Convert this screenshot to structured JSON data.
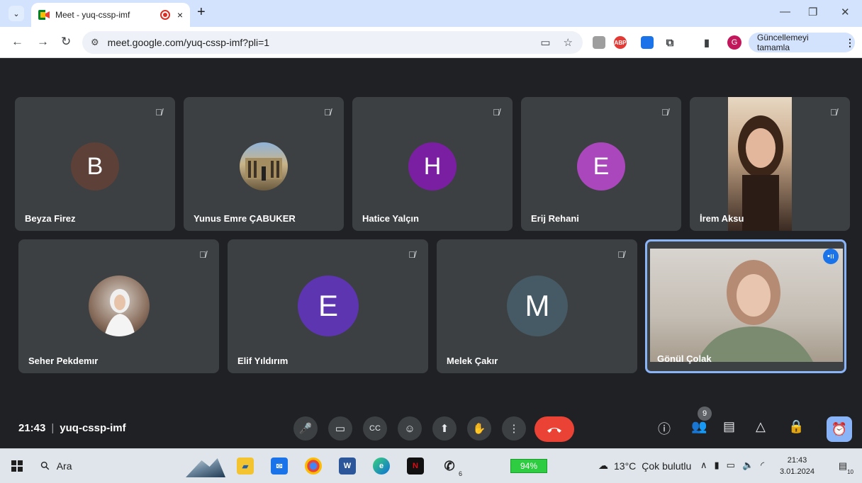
{
  "browser": {
    "tab_title": "Meet - yuq-cssp-imf",
    "tab_close": "×",
    "new_tab": "+",
    "url": "meet.google.com/yuq-cssp-imf?pli=1",
    "update_label": "Güncellemeyi tamamla",
    "profile_initial": "G",
    "abp_label": "ABP"
  },
  "participants": [
    {
      "name": "Beyza Firez",
      "initial": "B",
      "color": "#5d4037",
      "type": "letter"
    },
    {
      "name": "Yunus Emre ÇABUKER",
      "initial": "",
      "color": "",
      "type": "photo"
    },
    {
      "name": "Hatice Yalçın",
      "initial": "H",
      "color": "#7b1fa2",
      "type": "letter"
    },
    {
      "name": "Erij Rehani",
      "initial": "E",
      "color": "#ab47bc",
      "type": "letter"
    },
    {
      "name": "İrem Aksu",
      "initial": "",
      "color": "",
      "type": "video"
    },
    {
      "name": "Seher Pekdemır",
      "initial": "",
      "color": "",
      "type": "photo"
    },
    {
      "name": "Elif Yıldırım",
      "initial": "E",
      "color": "#5e35b1",
      "type": "letter"
    },
    {
      "name": "Melek Çakır",
      "initial": "M",
      "color": "#455a64",
      "type": "letter"
    },
    {
      "name": "Gönül Çolak",
      "initial": "",
      "color": "",
      "type": "video"
    }
  ],
  "meeting": {
    "time": "21:43",
    "code": "yuq-cssp-imf",
    "participant_count": "9"
  },
  "taskbar": {
    "search_label": "Ara",
    "battery": "94%",
    "whatsapp_badge": "6",
    "weather_temp": "13°C",
    "weather_text": "Çok bulutlu",
    "clock_time": "21:43",
    "clock_date": "3.01.2024",
    "notification_count": "10"
  }
}
